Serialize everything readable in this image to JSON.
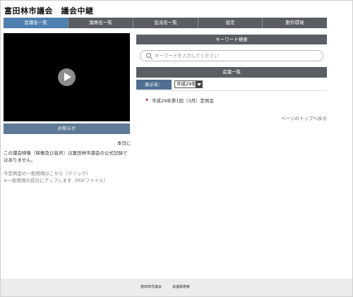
{
  "header": {
    "title": "富田林市議会　議会中継"
  },
  "nav": [
    {
      "label": "会議名一覧"
    },
    {
      "label": "議員名一覧"
    },
    {
      "label": "会派名一覧"
    },
    {
      "label": "設定"
    },
    {
      "label": "動作環境"
    }
  ],
  "notice": {
    "bar_label": "お知らせ",
    "today": "本日に",
    "text": "この議会映像（映像及び音声）は富田林市議会の公式記録ではありません。",
    "link": "今定例会の一般質問はこちら（クリック）",
    "pdf_note": "※一般質問の前日にアップします（PDFファイル）"
  },
  "keyword": {
    "bar_label": "キーワード検索",
    "placeholder": "キーワードを入力してください"
  },
  "meetings": {
    "bar_label": "会議一覧",
    "year_label": "表示年：",
    "year_value": "平成29年",
    "items": [
      {
        "label": "平成29年第1回（3月）定例会"
      }
    ],
    "back_to_top": "ページのトップへ戻る"
  },
  "footer": {
    "link1": "富田林市議会",
    "link2": "会議録検索"
  },
  "colors": {
    "nav_bg": "#5a5e63",
    "nav_active": "#4f7fb0",
    "accent_bar": "#5f7a96",
    "bullet": "#c23c3c"
  },
  "icons": {
    "search": "search-icon",
    "play": "play-icon",
    "dropdown": "chevron-down-icon"
  }
}
